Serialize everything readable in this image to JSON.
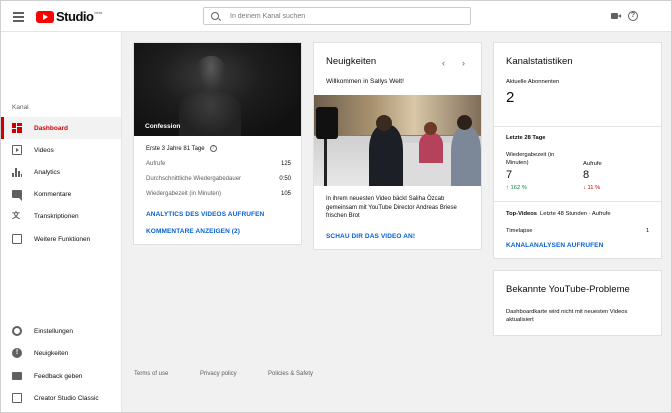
{
  "header": {
    "logo_text": "Studio",
    "logo_beta": "beta",
    "search_placeholder": "In deinem Kanal suchen"
  },
  "sidebar": {
    "section_label": "Kanal",
    "items": [
      {
        "label": "Dashboard",
        "icon": "dashboard-icon",
        "active": true
      },
      {
        "label": "Videos",
        "icon": "video-icon"
      },
      {
        "label": "Analytics",
        "icon": "analytics-icon"
      },
      {
        "label": "Kommentare",
        "icon": "comments-icon"
      },
      {
        "label": "Transkriptionen",
        "icon": "translate-icon"
      },
      {
        "label": "Weitere Funktionen",
        "icon": "more-features-icon"
      }
    ],
    "bottom_items": [
      {
        "label": "Einstellungen",
        "icon": "gear-icon"
      },
      {
        "label": "Neuigkeiten",
        "icon": "info-icon"
      },
      {
        "label": "Feedback geben",
        "icon": "feedback-icon"
      },
      {
        "label": "Creator Studio Classic",
        "icon": "classic-icon"
      }
    ]
  },
  "video_card": {
    "thumb_title": "Confession",
    "period": "Erste 3 Jahre 81 Tage",
    "stats": [
      {
        "label": "Aufrufe",
        "value": "125"
      },
      {
        "label": "Durchschnittliche Wiedergabedauer",
        "value": "0:50"
      },
      {
        "label": "Wiedergabezeit (in Minuten)",
        "value": "105"
      }
    ],
    "link_analytics": "ANALYTICS DES VIDEOS AUFRUFEN",
    "link_comments": "KOMMENTARE ANZEIGEN (2)"
  },
  "news_card": {
    "title": "Neuigkeiten",
    "prev": "‹",
    "next": "›",
    "headline": "Willkommen in Sallys Welt!",
    "body": "In ihrem neuesten Video bäckt Saliha Özcab gemeinsam mit YouTube Director Andreas Briese frischen Brot",
    "link": "SCHAU DIR DAS VIDEO AN!"
  },
  "stats_card": {
    "title": "Kanalstatistiken",
    "subs_label": "Aktuelle Abonnenten",
    "subs_value": "2",
    "period": "Letzte 28 Tage",
    "watch_label": "Wiedergabezeit (in Minuten)",
    "watch_value": "7",
    "watch_change": "↑ 162 %",
    "views_label": "Aufrufe",
    "views_value": "8",
    "views_change": "↓ 11 %",
    "top_label": "Top-Videos",
    "top_period": "Letzte 48 Stunden · Aufrufe",
    "top_video": "Timelapse",
    "top_video_views": "1",
    "link": "KANALANALYSEN AUFRUFEN"
  },
  "problems_card": {
    "title": "Bekannte YouTube-Probleme",
    "text": "Dashboardkarte wird nicht mit neuesten Videos aktualisiert"
  },
  "footer": {
    "terms": "Terms of use",
    "privacy": "Privacy policy",
    "policies": "Policies & Safety"
  },
  "colors": {
    "accent_red": "#cc0000",
    "link_blue": "#065fd4",
    "up_green": "#0a8a3a"
  }
}
